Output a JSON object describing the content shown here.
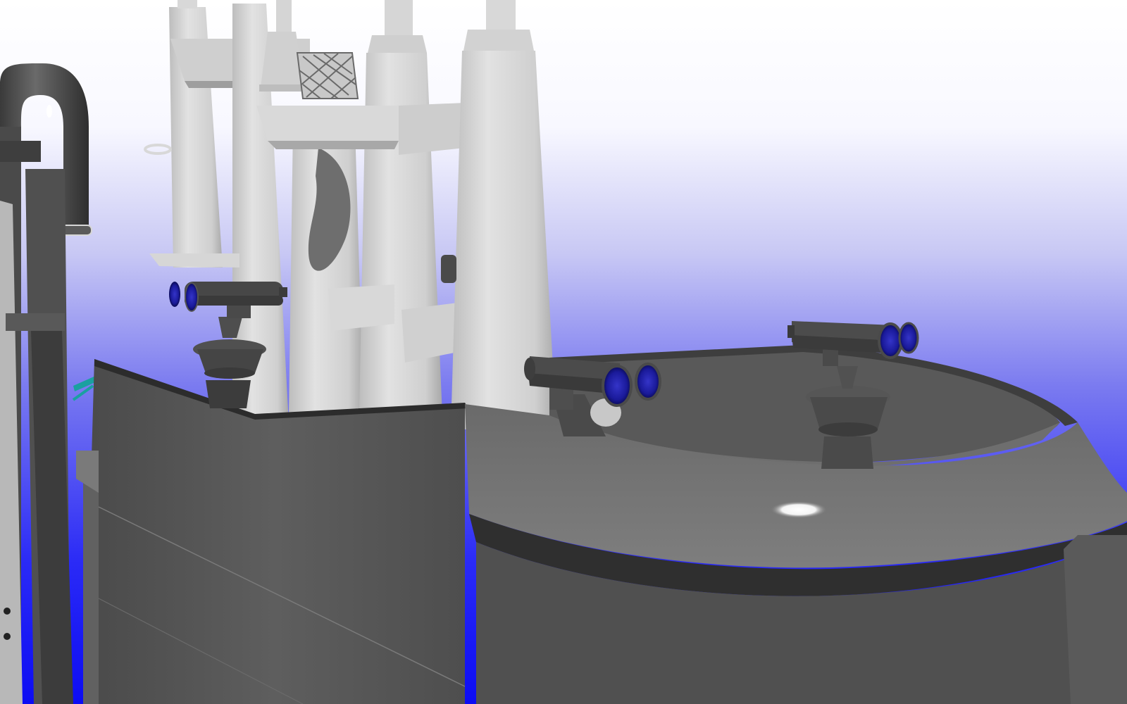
{
  "scene": {
    "description_visible_text": "",
    "colors": {
      "sky_top": "#ffffff",
      "sky_mid": "#c8c8f4",
      "sky_bottom": "#1010f5",
      "hull_dark": "#3a3a3a",
      "hull_mid": "#565656",
      "hull_light": "#7a7a7a",
      "mast_light": "#d4d4d4",
      "mast_shadow": "#9a9a9a",
      "lens_blue": "#2a2ab8",
      "cable_teal": "#1aa0a0",
      "highlight": "#ffffff"
    },
    "icons": [
      "binocular-icon",
      "periscope-icon",
      "exhaust-pipe-icon"
    ]
  }
}
